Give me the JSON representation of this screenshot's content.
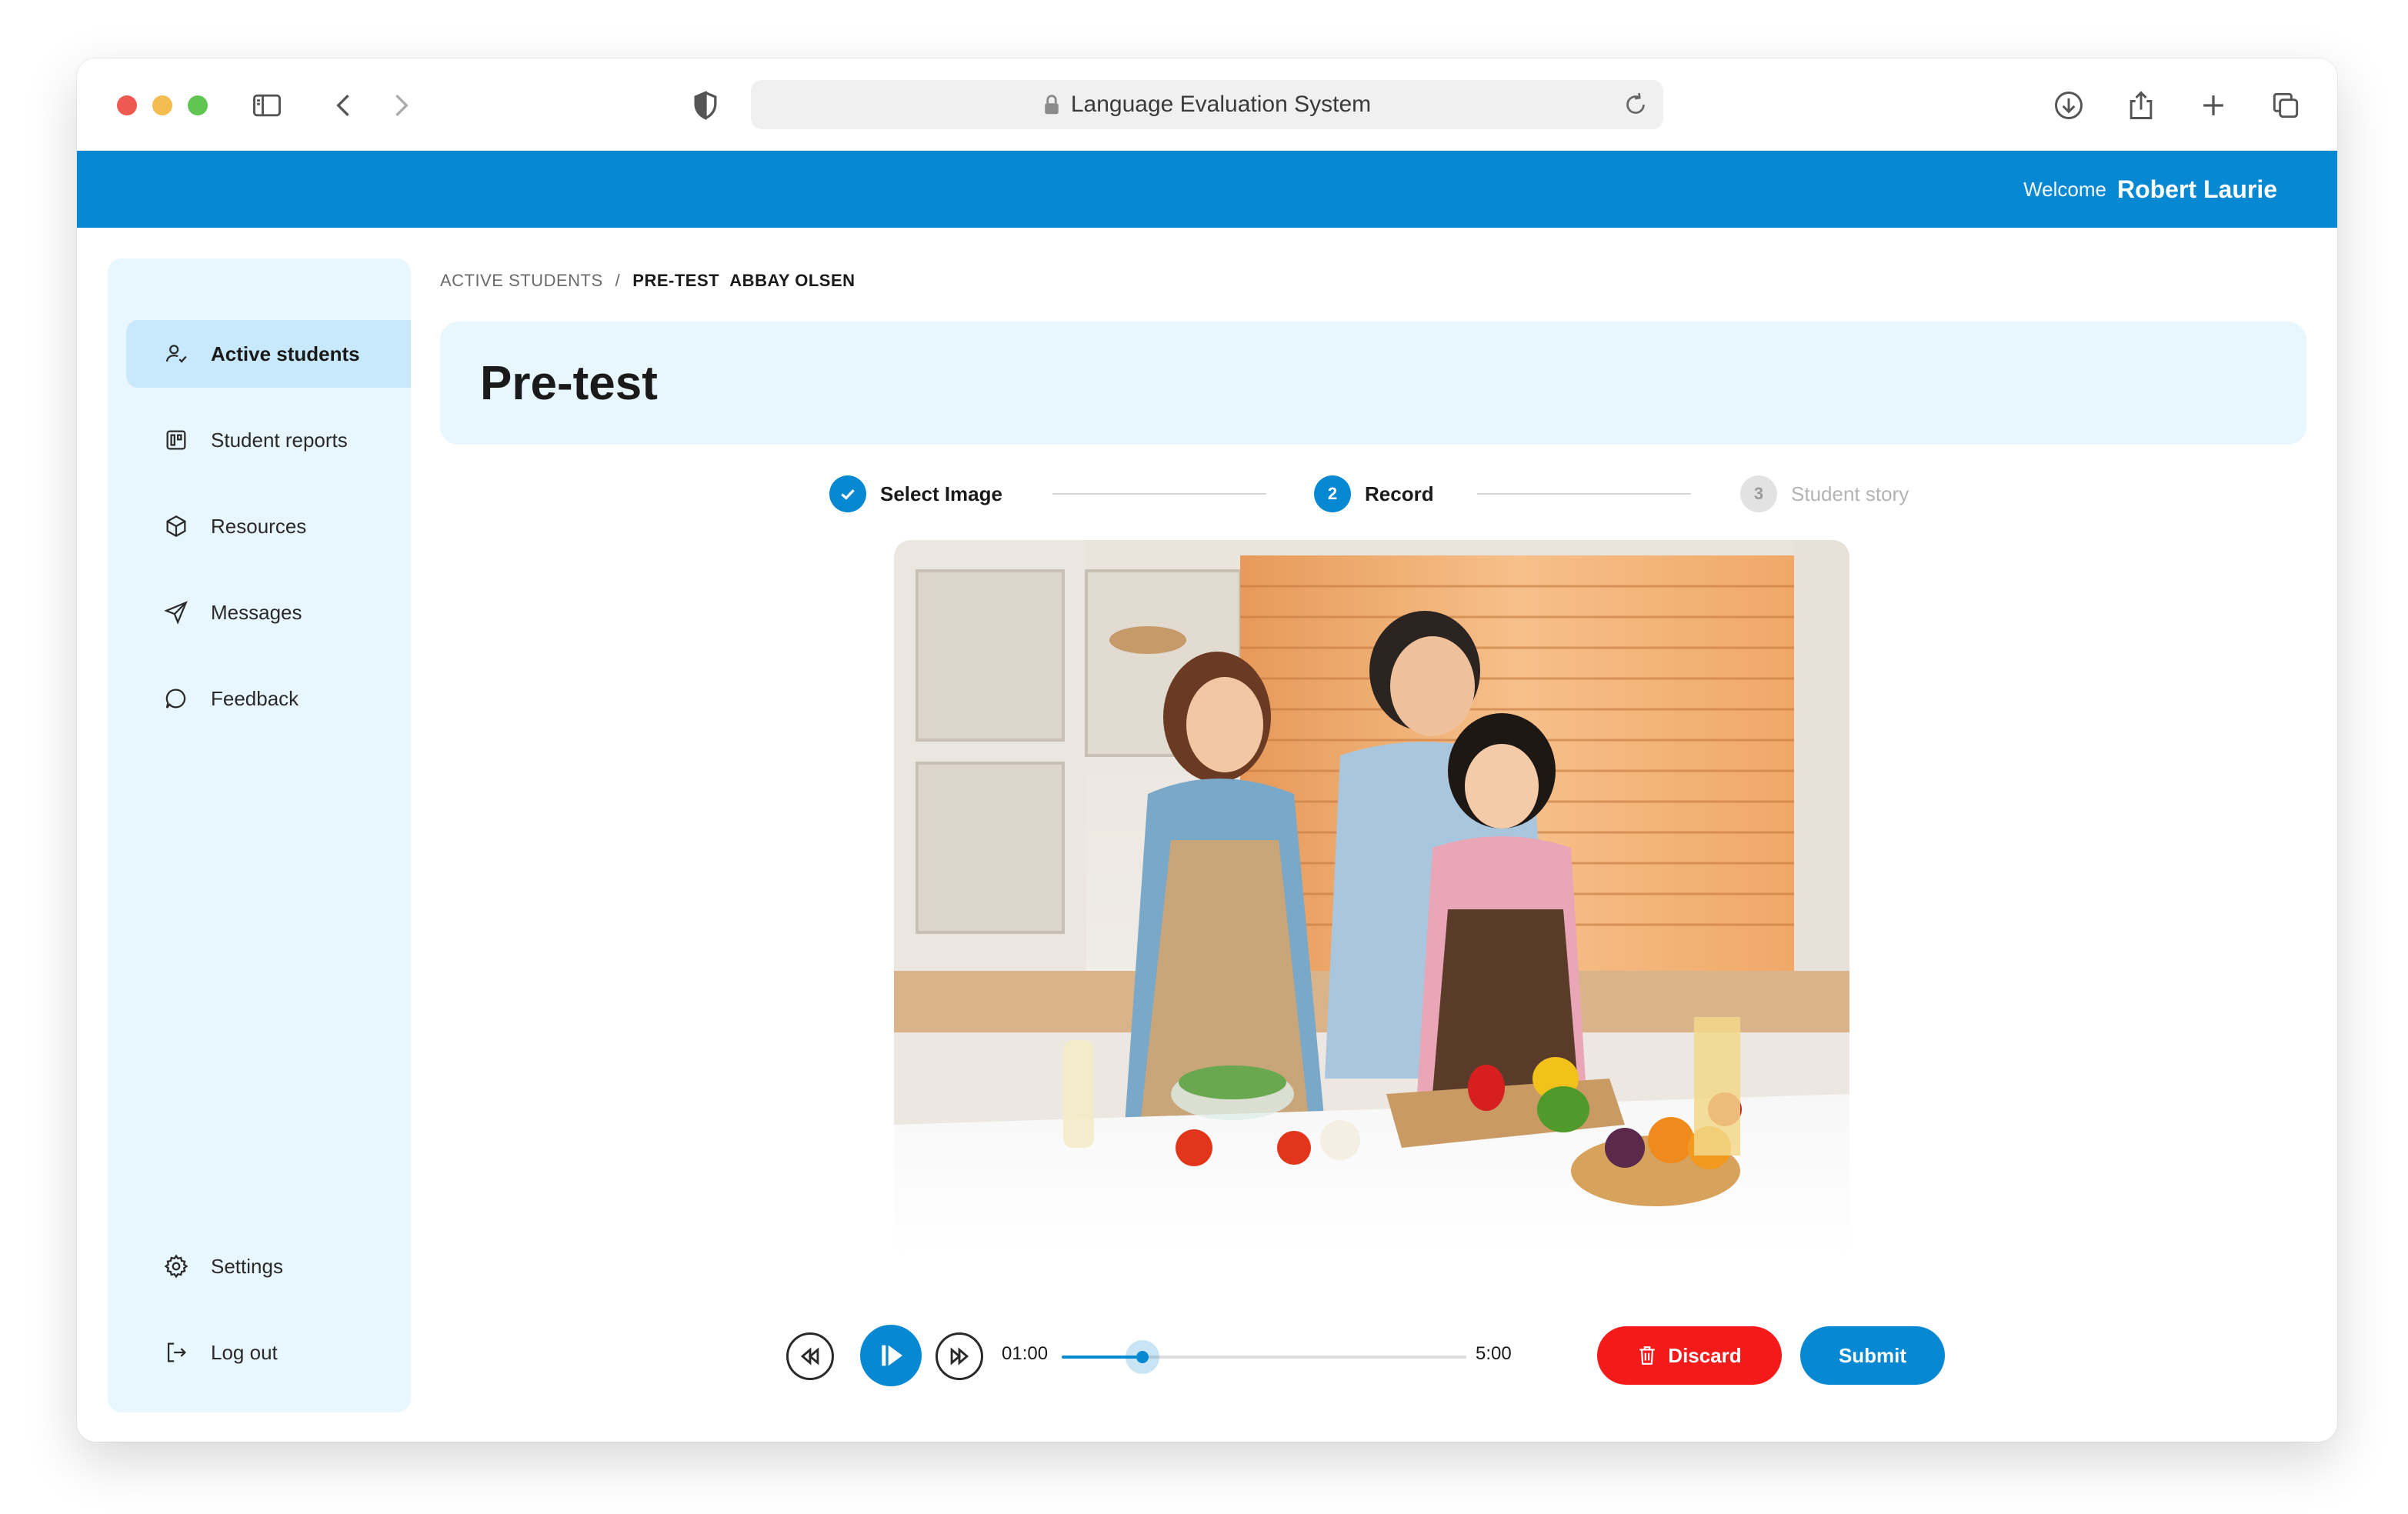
{
  "browser": {
    "address_text": "Language Evaluation System",
    "icons": [
      "sidebar-toggle-icon",
      "back-icon",
      "forward-icon",
      "shield-icon",
      "lock-icon",
      "reload-icon",
      "download-icon",
      "share-icon",
      "new-tab-icon",
      "tabs-icon"
    ]
  },
  "header": {
    "welcome_label": "Welcome",
    "user_name": "Robert Laurie"
  },
  "sidebar": {
    "items": [
      {
        "label": "Active students",
        "icon": "user-check-icon",
        "active": true
      },
      {
        "label": "Student reports",
        "icon": "report-icon",
        "active": false
      },
      {
        "label": "Resources",
        "icon": "box-icon",
        "active": false
      },
      {
        "label": "Messages",
        "icon": "send-icon",
        "active": false
      },
      {
        "label": "Feedback",
        "icon": "chat-bubble-icon",
        "active": false
      }
    ],
    "bottom_items": [
      {
        "label": "Settings",
        "icon": "gear-icon"
      },
      {
        "label": "Log out",
        "icon": "logout-icon"
      }
    ]
  },
  "breadcrumb": {
    "root": "ACTIVE STUDENTS",
    "separator": "/",
    "current_prefix": "PRE-TEST",
    "current_name": "ABBAY OLSEN"
  },
  "page": {
    "title": "Pre-test"
  },
  "stepper": {
    "steps": [
      {
        "number": "1",
        "label": "Select Image",
        "state": "done"
      },
      {
        "number": "2",
        "label": "Record",
        "state": "current"
      },
      {
        "number": "3",
        "label": "Student story",
        "state": "pending"
      }
    ]
  },
  "player": {
    "current_time": "01:00",
    "total_time": "5:00",
    "progress": 0.2,
    "discard_label": "Discard",
    "submit_label": "Submit"
  },
  "colors": {
    "accent": "#0788d2",
    "sidebar_bg": "#e8f6fe",
    "danger": "#f41a1a"
  }
}
